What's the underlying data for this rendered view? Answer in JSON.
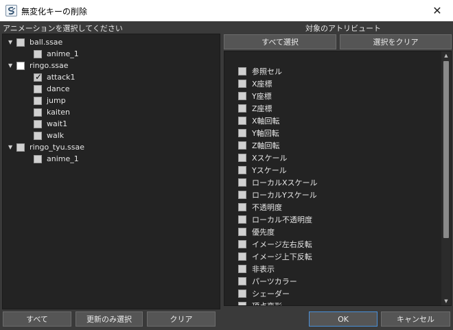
{
  "window": {
    "title": "無変化キーの削除",
    "close": "✕"
  },
  "left": {
    "header": "アニメーションを選択してください",
    "tree": [
      {
        "name": "ball.ssae",
        "level": 0,
        "expanded": true,
        "checked": false,
        "white": false
      },
      {
        "name": "anime_1",
        "level": 1,
        "checked": false
      },
      {
        "name": "ringo.ssae",
        "level": 0,
        "expanded": true,
        "checked": false,
        "white": true
      },
      {
        "name": "attack1",
        "level": 1,
        "checked": true
      },
      {
        "name": "dance",
        "level": 1,
        "checked": false
      },
      {
        "name": "jump",
        "level": 1,
        "checked": false
      },
      {
        "name": "kaiten",
        "level": 1,
        "checked": false
      },
      {
        "name": "wait1",
        "level": 1,
        "checked": false
      },
      {
        "name": "walk",
        "level": 1,
        "checked": false
      },
      {
        "name": "ringo_tyu.ssae",
        "level": 0,
        "expanded": true,
        "checked": false,
        "white": false
      },
      {
        "name": "anime_1",
        "level": 1,
        "checked": false
      }
    ],
    "buttons": {
      "all": "すべて",
      "updated_only": "更新のみ選択",
      "clear": "クリア"
    }
  },
  "right": {
    "header": "対象のアトリビュート",
    "buttons": {
      "select_all": "すべて選択",
      "clear_selection": "選択をクリア"
    },
    "attributes": [
      "参照セル",
      "X座標",
      "Y座標",
      "Z座標",
      "X軸回転",
      "Y軸回転",
      "Z軸回転",
      "Xスケール",
      "Yスケール",
      "ローカルXスケール",
      "ローカルYスケール",
      "不透明度",
      "ローカル不透明度",
      "優先度",
      "イメージ左右反転",
      "イメージ上下反転",
      "非表示",
      "パーツカラー",
      "シェーダー",
      "頂点変形"
    ]
  },
  "footer": {
    "ok": "OK",
    "cancel": "キャンセル"
  }
}
